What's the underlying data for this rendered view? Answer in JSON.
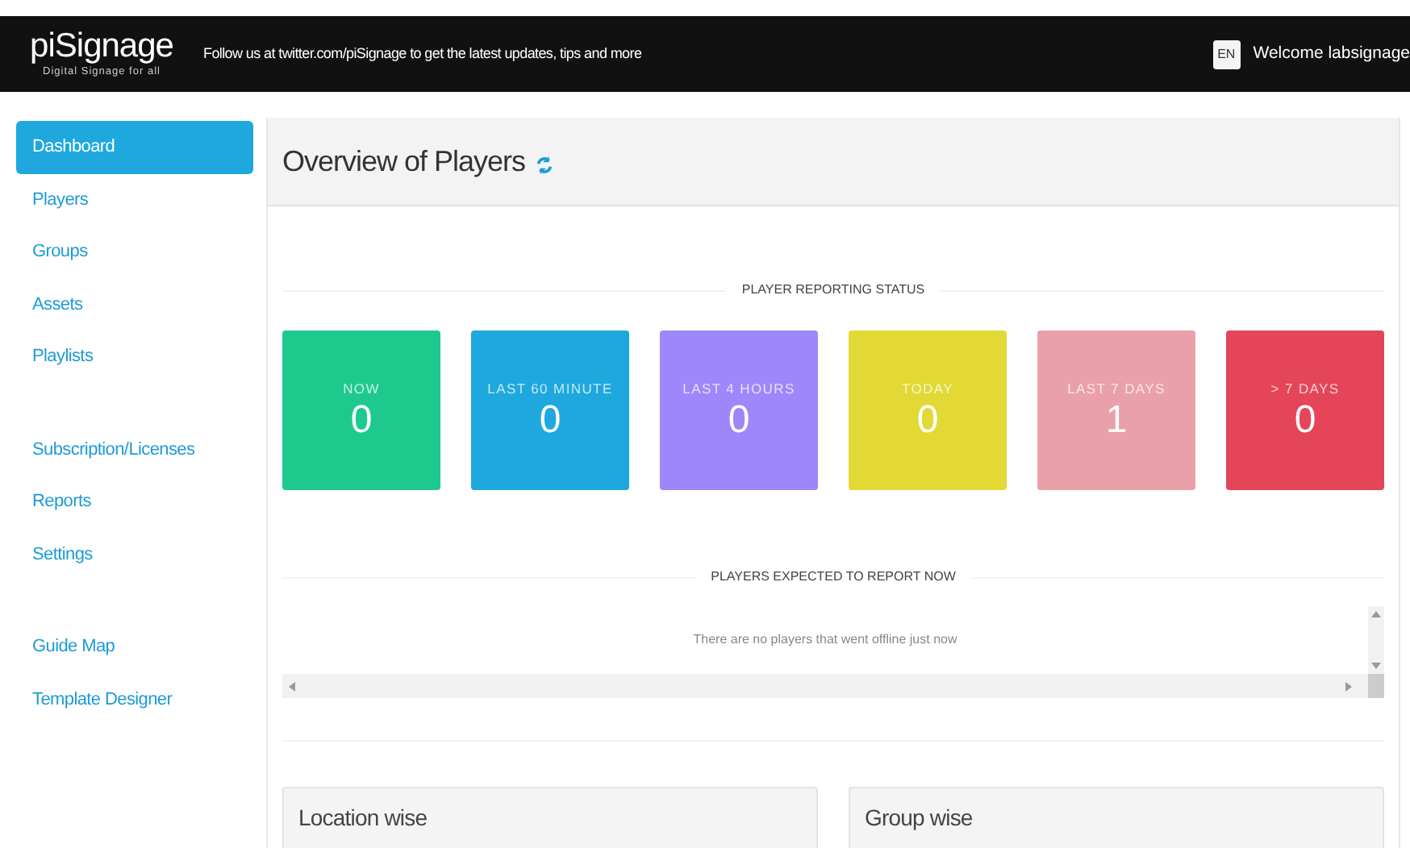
{
  "topbar": {
    "logo": "piSignage",
    "tagline": "Digital Signage for all",
    "message": "Follow us at twitter.com/piSignage to get the latest updates, tips and more",
    "language": "EN",
    "welcome": "Welcome labsignage"
  },
  "sidebar": {
    "sections": [
      [
        {
          "label": "Dashboard",
          "selected": true
        },
        {
          "label": "Players",
          "selected": false
        },
        {
          "label": "Groups",
          "selected": false
        },
        {
          "label": "Assets",
          "selected": false
        },
        {
          "label": "Playlists",
          "selected": false
        }
      ],
      [
        {
          "label": "Subscription/Licenses",
          "selected": false
        },
        {
          "label": "Reports",
          "selected": false
        },
        {
          "label": "Settings",
          "selected": false
        }
      ],
      [
        {
          "label": "Guide Map",
          "selected": false
        },
        {
          "label": "Template Designer",
          "selected": false
        }
      ]
    ]
  },
  "page": {
    "title": "Overview of Players"
  },
  "status": {
    "heading": "PLAYER REPORTING STATUS",
    "tiles": [
      {
        "label": "NOW",
        "count": "0",
        "color": "#1ec98e"
      },
      {
        "label": "LAST 60 MINUTE",
        "count": "0",
        "color": "#1ea8de"
      },
      {
        "label": "LAST 4 HOURS",
        "count": "0",
        "color": "#9d87fb"
      },
      {
        "label": "TODAY",
        "count": "0",
        "color": "#e2d934"
      },
      {
        "label": "LAST 7 DAYS",
        "count": "1",
        "color": "#e9a0a9"
      },
      {
        "label": "> 7 DAYS",
        "count": "0",
        "color": "#e44558"
      }
    ]
  },
  "expected": {
    "heading": "PLAYERS EXPECTED TO REPORT NOW",
    "message": "There are no players that went offline just now"
  },
  "panels": [
    {
      "title": "Location wise"
    },
    {
      "title": "Group wise"
    }
  ]
}
